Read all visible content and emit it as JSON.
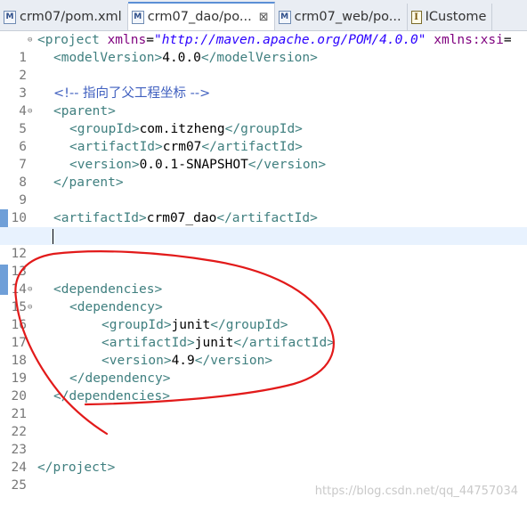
{
  "tabs": [
    {
      "label": "crm07/pom.xml",
      "icon": "maven-file-icon",
      "active": false
    },
    {
      "label": "crm07_dao/po...",
      "icon": "maven-file-icon",
      "active": true,
      "close": "⊠"
    },
    {
      "label": "crm07_web/po...",
      "icon": "maven-file-icon",
      "active": false
    },
    {
      "label": "ICustome",
      "icon": "java-interface-icon",
      "active": false
    }
  ],
  "editor": {
    "lines": [
      {
        "n": "1",
        "fold": "⊖"
      },
      {
        "n": "2"
      },
      {
        "n": "3"
      },
      {
        "n": "4"
      },
      {
        "n": "5",
        "fold": "⊖"
      },
      {
        "n": "6"
      },
      {
        "n": "7"
      },
      {
        "n": "8"
      },
      {
        "n": "9"
      },
      {
        "n": "10"
      },
      {
        "n": "11"
      },
      {
        "n": "12"
      },
      {
        "n": "13"
      },
      {
        "n": "14"
      },
      {
        "n": "15",
        "fold": "⊖"
      },
      {
        "n": "16",
        "fold": "⊖"
      },
      {
        "n": "17"
      },
      {
        "n": "18"
      },
      {
        "n": "19"
      },
      {
        "n": "20"
      },
      {
        "n": "21"
      },
      {
        "n": "22"
      },
      {
        "n": "23"
      },
      {
        "n": "24"
      },
      {
        "n": "25"
      }
    ],
    "code": {
      "l1_tag": "<project",
      "l1_attr1": " xmlns",
      "l1_eq1": "=",
      "l1_val1": "\"http://maven.apache.org/POM/4.0.0\"",
      "l1_attr2": " xmlns:xsi",
      "l1_eq2": "=",
      "l2_open": "<modelVersion>",
      "l2_text": "4.0.0",
      "l2_close": "</modelVersion>",
      "l4_comment": "<!-- 指向了父工程坐标 -->",
      "l5_tag": "<parent>",
      "l6_open": "<groupId>",
      "l6_text": "com.itzheng",
      "l6_close": "</groupId>",
      "l7_open": "<artifactId>",
      "l7_text": "crm07",
      "l7_close": "</artifactId>",
      "l8_open": "<version>",
      "l8_text": "0.0.1-SNAPSHOT",
      "l8_close": "</version>",
      "l9_tag": "</parent>",
      "l11_open": "<artifactId>",
      "l11_text": "crm07_dao",
      "l11_close": "</artifactId>",
      "l15_tag": "<dependencies>",
      "l16_tag": "<dependency>",
      "l17_open": "<groupId>",
      "l17_text": "junit",
      "l17_close": "</groupId>",
      "l18_open": "<artifactId>",
      "l18_text": "junit",
      "l18_close": "</artifactId>",
      "l19_open": "<version>",
      "l19_text": "4.9",
      "l19_close": "</version>",
      "l20_tag": "</dependency>",
      "l21_tag": "</dependencies>",
      "l25_tag": "</project>"
    }
  },
  "watermark": "https://blog.csdn.net/qq_44757034",
  "colors": {
    "tag": "#3f7f7f",
    "attribute": "#7f007f",
    "string": "#2a00ff",
    "comment": "#3f5fbf",
    "current_line": "#e8f2fe",
    "annotation_stroke": "#e21a1a"
  }
}
